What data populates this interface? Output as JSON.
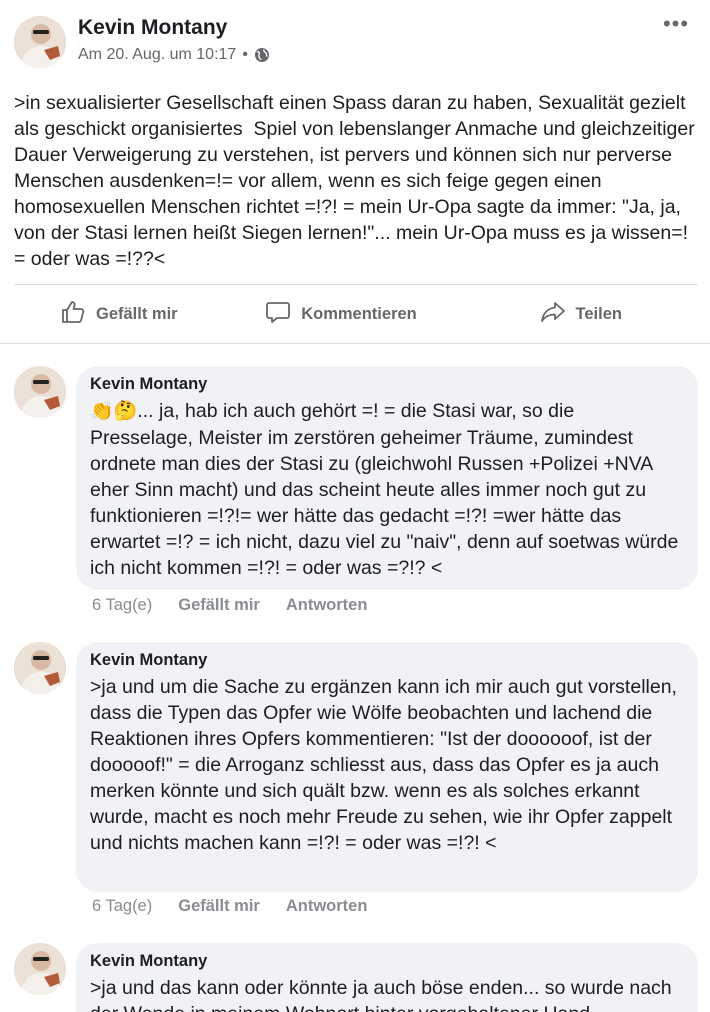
{
  "post": {
    "author": "Kevin Montany",
    "timestamp": "Am 20. Aug. um 10:17",
    "separator": "•",
    "privacy_icon": "globe-icon",
    "more_icon": "more-options-icon",
    "text": ">in sexualisierter Gesellschaft einen Spass daran zu haben, Sexualität gezielt als geschickt organisiertes  Spiel von lebenslanger Anmache und gleichzeitiger Dauer Verweigerung zu verstehen, ist pervers und können sich nur perverse Menschen ausdenken=!= vor allem, wenn es sich feige gegen einen homosexuellen Menschen richtet =!?! = mein Ur-Opa sagte da immer: \"Ja, ja, von der Stasi lernen heißt Siegen lernen!\"... mein Ur-Opa muss es ja wissen=! = oder was =!??<"
  },
  "actions": {
    "like": "Gefällt mir",
    "comment": "Kommentieren",
    "share": "Teilen"
  },
  "comments": [
    {
      "author": "Kevin Montany",
      "emoji": "👏🤔",
      "text": "... ja, hab ich auch gehört =! = die Stasi war, so die Presselage, Meister im zerstören geheimer Träume, zumindest ordnete man dies der Stasi zu (gleichwohl Russen +Polizei +NVA eher Sinn macht) und das scheint heute alles immer noch gut zu funktionieren =!?!= wer hätte das gedacht =!?! =wer hätte das erwartet =!? = ich nicht, dazu viel zu \"naiv\", denn auf soetwas würde ich nicht kommen =!?! = oder was =?!? <",
      "time": "6 Tag(e)",
      "like": "Gefällt mir",
      "reply": "Antworten"
    },
    {
      "author": "Kevin Montany",
      "text": ">ja und um die Sache zu ergänzen kann ich mir auch gut vorstellen, dass die Typen das Opfer wie Wölfe beobachten und lachend die Reaktionen ihres Opfers kommentieren: \"Ist der doooooof, ist der dooooof!\" = die Arroganz schliesst aus, dass das Opfer es ja auch merken könnte und sich quält bzw. wenn es als solches erkannt wurde, macht es noch mehr Freude zu sehen, wie ihr Opfer zappelt und nichts machen kann =!?! = oder was =!?! <",
      "time": "6 Tag(e)",
      "like": "Gefällt mir",
      "reply": "Antworten"
    },
    {
      "author": "Kevin Montany",
      "text": ">ja und das kann oder könnte ja auch böse enden... so wurde nach der Wende in meinem Wohnort hinter vorgehaltener Hand"
    }
  ]
}
